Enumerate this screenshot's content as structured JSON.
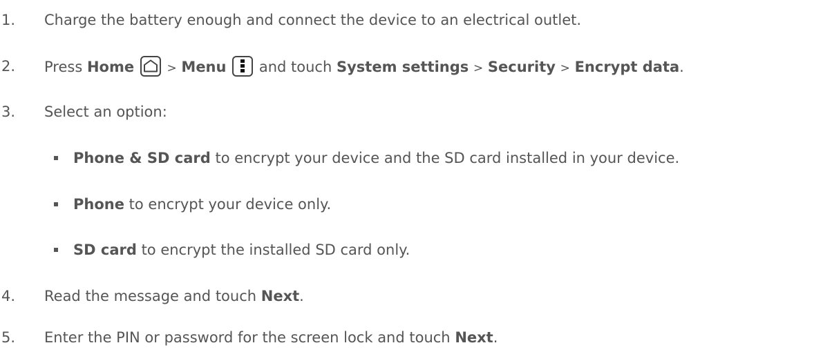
{
  "steps": [
    {
      "number": "1.",
      "text": "Charge the battery enough and connect the device to an electrical outlet."
    },
    {
      "number": "2.",
      "press": "Press",
      "home": "Home",
      "gt1": ">",
      "menu": "Menu",
      "and_touch": "and touch",
      "system_settings": "System settings",
      "gt2": ">",
      "security": "Security",
      "gt3": ">",
      "encrypt_data": "Encrypt data",
      "period": "."
    },
    {
      "number": "3.",
      "text": "Select an option:",
      "options": [
        {
          "bold": "Phone & SD card",
          "rest": "to encrypt your device and the SD card installed in your device."
        },
        {
          "bold": "Phone",
          "rest": "to encrypt your device only."
        },
        {
          "bold": "SD card",
          "rest": "to encrypt the installed SD card only."
        }
      ]
    },
    {
      "number": "4.",
      "text": "Read the message and touch",
      "bold": "Next",
      "period": "."
    },
    {
      "number": "5.",
      "text": "Enter the PIN or password for the screen lock and touch",
      "bold": "Next",
      "period": "."
    }
  ],
  "icons": {
    "home": "home-icon",
    "menu": "menu-icon"
  }
}
